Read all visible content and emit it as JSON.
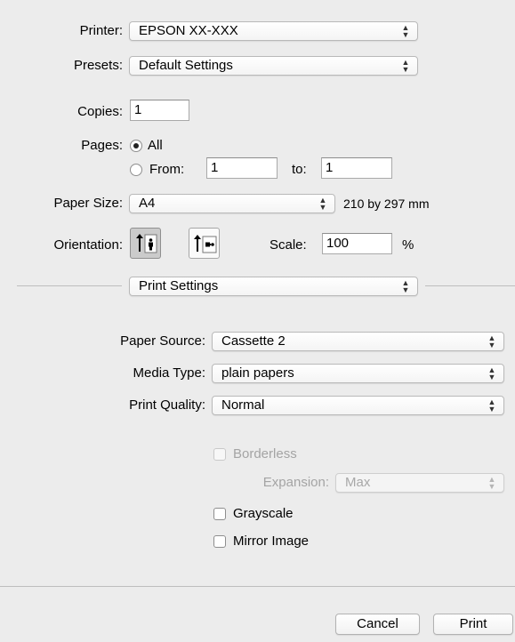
{
  "printer": {
    "label": "Printer:",
    "value": "EPSON XX-XXX"
  },
  "presets": {
    "label": "Presets:",
    "value": "Default Settings"
  },
  "copies": {
    "label": "Copies:",
    "value": "1"
  },
  "pages": {
    "label": "Pages:",
    "all_label": "All",
    "from_label": "From:",
    "from_value": "1",
    "to_label": "to:",
    "to_value": "1",
    "selected": "All"
  },
  "paper_size": {
    "label": "Paper Size:",
    "value": "A4",
    "dimensions": "210 by 297 mm"
  },
  "orientation": {
    "label": "Orientation:",
    "selected": "portrait"
  },
  "scale": {
    "label": "Scale:",
    "value": "100",
    "unit": "%"
  },
  "section": {
    "value": "Print Settings"
  },
  "paper_source": {
    "label": "Paper Source:",
    "value": "Cassette 2"
  },
  "media_type": {
    "label": "Media Type:",
    "value": "plain papers"
  },
  "print_quality": {
    "label": "Print Quality:",
    "value": "Normal"
  },
  "borderless": {
    "label": "Borderless",
    "checked": false,
    "enabled": false
  },
  "expansion": {
    "label": "Expansion:",
    "value": "Max",
    "enabled": false
  },
  "grayscale": {
    "label": "Grayscale",
    "checked": false
  },
  "mirror_image": {
    "label": "Mirror Image",
    "checked": false
  },
  "buttons": {
    "cancel": "Cancel",
    "print": "Print"
  }
}
